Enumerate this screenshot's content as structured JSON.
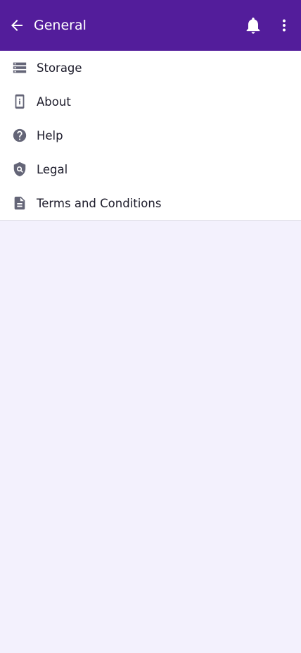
{
  "app_bar": {
    "title": "General",
    "background": "#531d9b",
    "icons": [
      "back-arrow-icon",
      "bell-icon",
      "more-vert-icon"
    ]
  },
  "menu": {
    "items": [
      {
        "label": "Storage",
        "icon": "storage-icon"
      },
      {
        "label": "About",
        "icon": "device-info-icon"
      },
      {
        "label": "Help",
        "icon": "help-icon"
      },
      {
        "label": "Legal",
        "icon": "policy-icon"
      },
      {
        "label": "Terms and Conditions",
        "icon": "document-icon"
      }
    ]
  },
  "colors": {
    "accent": "#531d9b",
    "icon": "#646577",
    "page_background": "#f3f1fd"
  }
}
